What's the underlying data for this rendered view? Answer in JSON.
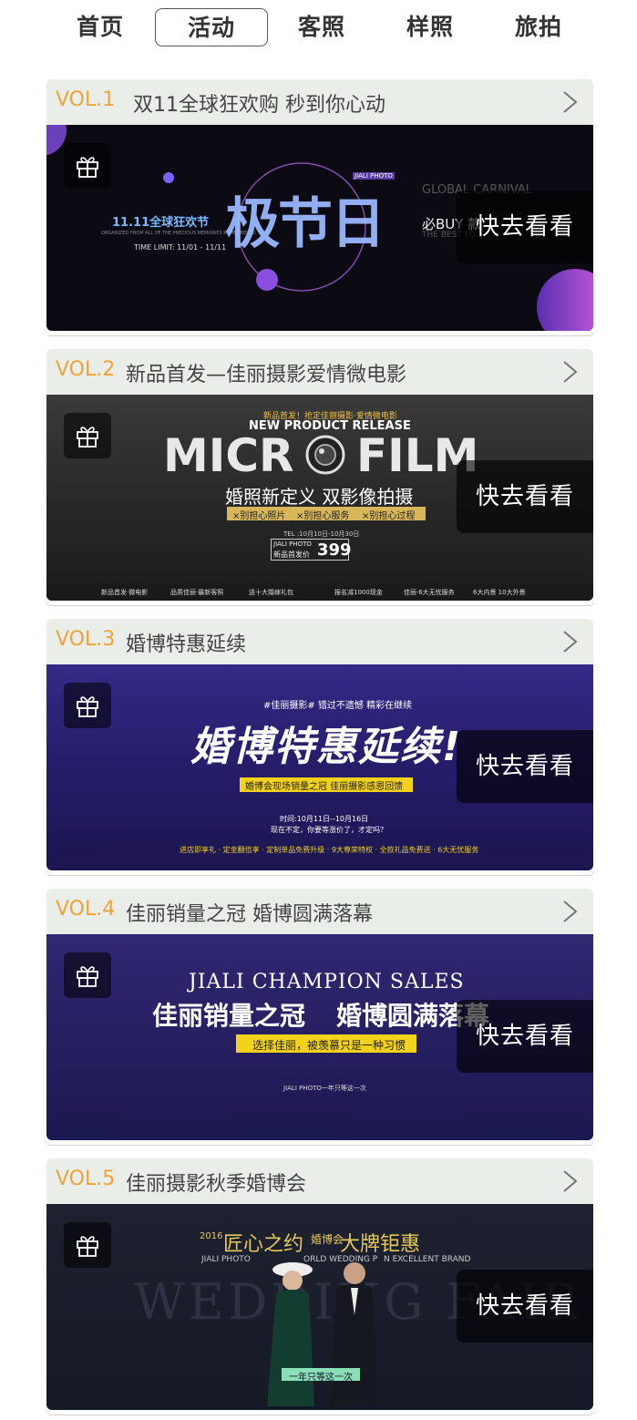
{
  "nav": {
    "items": [
      "首页",
      "活动",
      "客照",
      "样照",
      "旅拍"
    ],
    "active_index": 1
  },
  "cta_label": "快去看看",
  "cards": [
    {
      "vol": "VOL.1",
      "title": "双11全球狂欢购 秒到你心动",
      "banner": {
        "headline": "极节日",
        "left_title": "11.11全球狂欢节",
        "left_small": "ORGANIZED FROM ALL OF THE PRECIOUS MEMORIES REMEMBERED",
        "time": "TIME LIMIT: 11/01 - 11/11",
        "brand_tag": "JIALI PHOTO",
        "right_a": "GLOBAL CARNIVAL",
        "right_b": "必BUY 款",
        "right_c": "THE BEST FO"
      }
    },
    {
      "vol": "VOL.2",
      "title": "新品首发—佳丽摄影爱情微电影",
      "banner": {
        "top": "新品首发！抢定佳丽摄影·爱情微电影",
        "release": "NEW PRODUCT RELEASE",
        "micro_a": "MICR",
        "micro_b": "FILM",
        "sub": "婚照新定义  双影像拍摄",
        "tags": [
          "×别担心照片",
          "×别担心服务",
          "×别担心过程"
        ],
        "tel": "TEL :10月10日-10月30日",
        "price_brand": "JIALI PHOTO",
        "price_label": "新品首发价",
        "price": "399",
        "foot": [
          "新品首发·微电影",
          "品质佳丽·最新客照",
          "送十大婚嫁礼包",
          "报名减1000现金",
          "佳丽·6大无忧服务",
          "6大内景 10大外景"
        ]
      }
    },
    {
      "vol": "VOL.3",
      "title": "婚博特惠延续",
      "banner": {
        "top": "#佳丽摄影#  错过不遗憾  精彩在继续",
        "headline": "婚博特惠延续!",
        "yellow": "婚博会现场销量之冠  佳丽摄影感恩回馈",
        "date": "时间:10月11日--10月16日",
        "question": "现在不定，你要等涨价了，才定吗？",
        "foot": "进店即享礼 · 定金翻倍享 · 定制单品免费升级 · 9大尊荣特权 · 全款礼品免费送 · 6大无忧服务"
      }
    },
    {
      "vol": "VOL.4",
      "title": "佳丽销量之冠 婚博圆满落幕",
      "banner": {
        "en": "JIALI CHAMPION SALES",
        "headline_a": "佳丽销量之冠",
        "headline_b": "婚博圆满落幕",
        "yellow": "选择佳丽，被羡慕只是一种习惯",
        "sub": "JIALI PHOTO一年只等这一次"
      }
    },
    {
      "vol": "VOL.5",
      "title": "佳丽摄影秋季婚博会",
      "banner": {
        "year": "2016",
        "headline_a": "匠心之约",
        "headline_mid": "婚博会",
        "headline_b": "大牌钜惠",
        "brand": "JIALI PHOTO",
        "brand_b": "ORLD WEDDING P",
        "brand_c": "N EXCELLENT BRAND",
        "bg": "WEDDING FAIR",
        "green": "一年只等这一次"
      }
    }
  ],
  "colors": {
    "vol": "#f0a236",
    "card_head": "#e9eee9",
    "banner1": "#0c0b14",
    "banner2": "#2c2c2c",
    "banner3": "#2a2270",
    "banner4": "#2c2566",
    "banner5": "#1a1e2b"
  }
}
